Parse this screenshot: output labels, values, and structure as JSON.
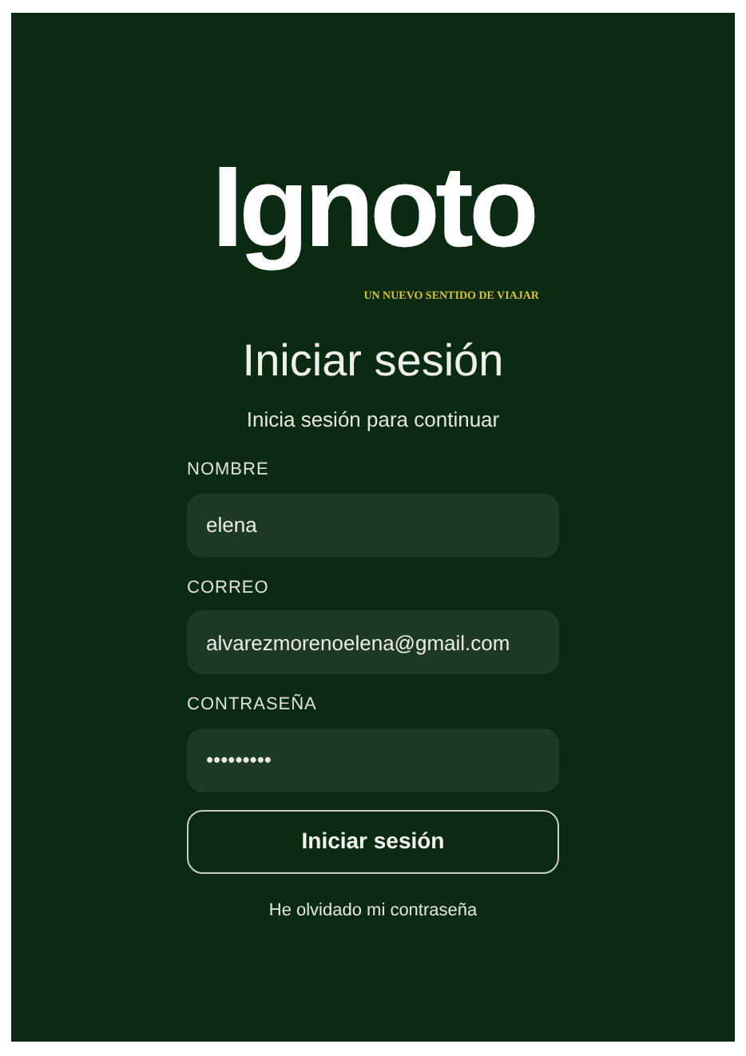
{
  "logo": {
    "name": "Ignoto",
    "tagline": "UN NUEVO SENTIDO DE VIAJAR"
  },
  "title": "Iniciar sesión",
  "subtitle": "Inicia sesión para continuar",
  "fields": [
    {
      "label": "NOMBRE",
      "value": "elena"
    },
    {
      "label": "CORREO",
      "value": "alvarezmorenoelena@gmail.com"
    },
    {
      "label": "CONTRASEÑA",
      "value": "•••••••••"
    }
  ],
  "submit_button": "Iniciar sesión",
  "forgot_link": "He olvidado mi contraseña"
}
